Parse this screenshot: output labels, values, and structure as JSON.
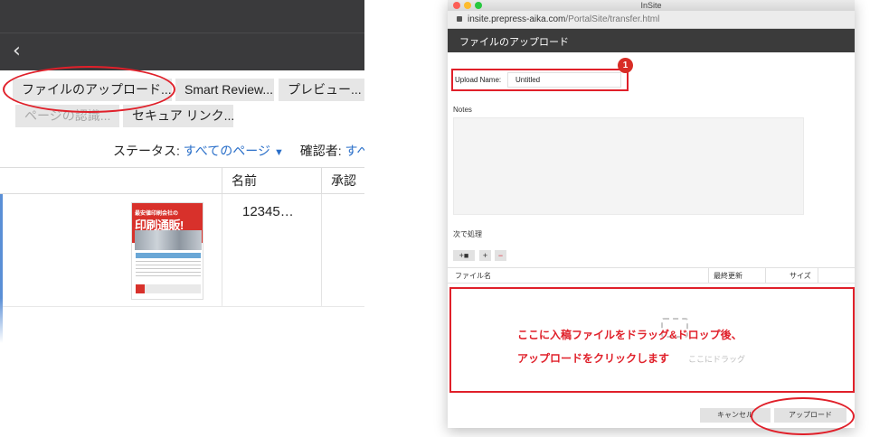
{
  "left": {
    "back_icon": "chevron-left-icon",
    "buttons": {
      "upload": "ファイルのアップロード...",
      "smart_review": "Smart Review...",
      "preview": "プレビュー...",
      "page_approve": "ページの認識...",
      "secure_link": "セキュア リンク..."
    },
    "status_label": "ステータス:",
    "status_value": "すべてのページ",
    "reviewer_label": "確認者:",
    "reviewer_value": "すべて",
    "columns": [
      "名前",
      "承認"
    ],
    "row": {
      "name": "12345…"
    },
    "flyer": {
      "line1": "最安値印刷会社の",
      "line2": "印刷通販!"
    }
  },
  "window": {
    "title": "InSite",
    "url_domain": "insite.prepress-aika.com",
    "url_path": "/PortalSite/transfer.html",
    "header": "ファイルのアップロード",
    "upload_name_label": "Upload Name:",
    "upload_name_value": "Untitled",
    "badge": "1",
    "notes_label": "Notes",
    "next_label": "次で処理",
    "file_columns": [
      "ファイル名",
      "最終更新",
      "サイズ"
    ],
    "drop_hint": "ここにドラッグ",
    "instruction_line1": "ここに入稿ファイルをドラッグ&ドロップ後、",
    "instruction_line2": "アップロードをクリックします",
    "cancel": "キャンセル",
    "upload": "アップロード"
  },
  "colors": {
    "annotation_red": "#e0202a",
    "dark_header": "#3b3b3b",
    "link_blue": "#2a6fc9"
  }
}
